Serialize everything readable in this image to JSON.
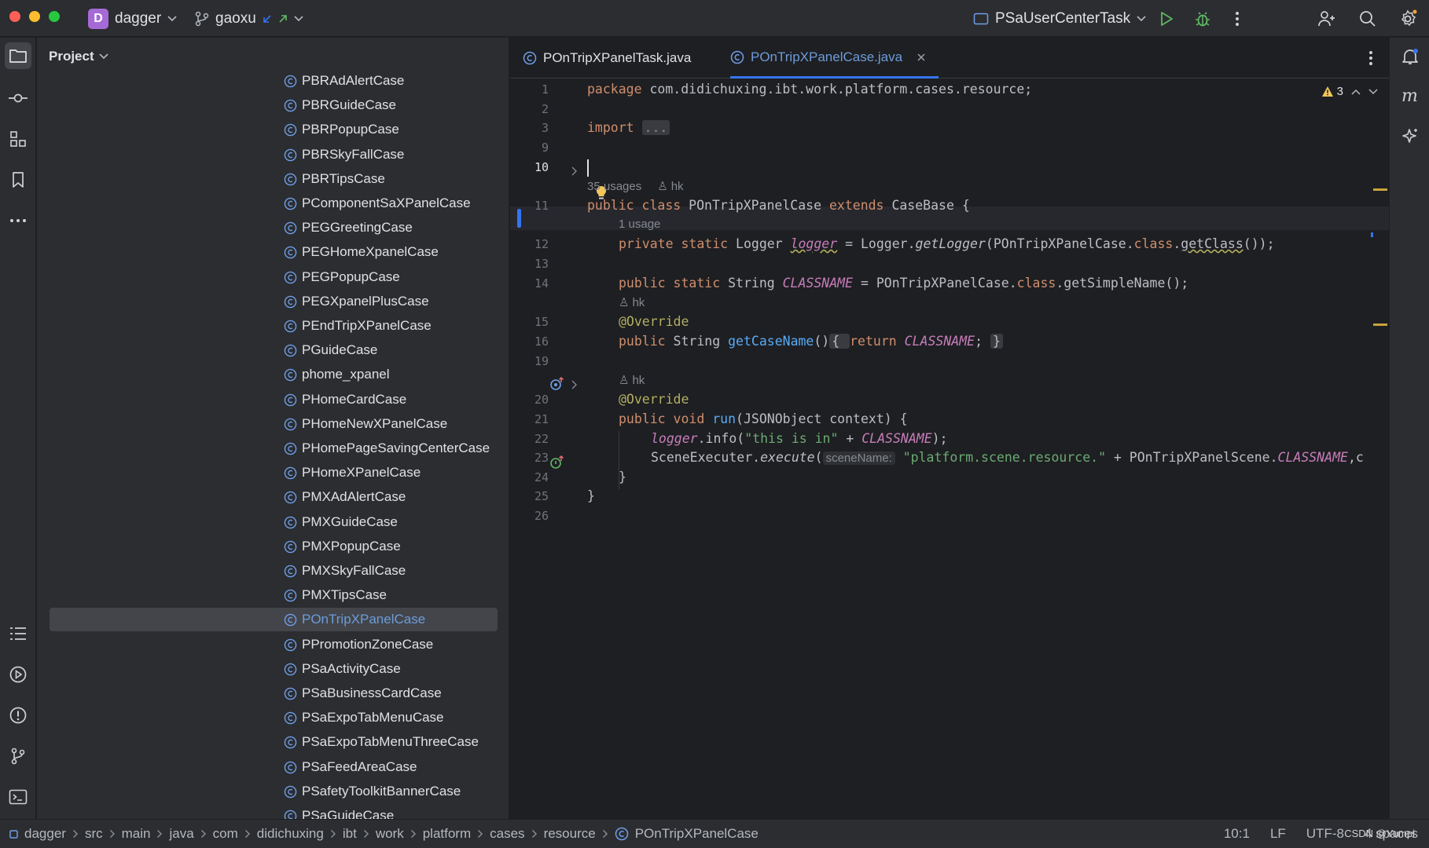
{
  "titlebar": {
    "project_badge": "D",
    "project_name": "dagger",
    "branch": "gaoxu",
    "run_config": "PSaUserCenterTask"
  },
  "project_panel": {
    "title": "Project",
    "items": [
      "PBRAdAlertCase",
      "PBRGuideCase",
      "PBRPopupCase",
      "PBRSkyFallCase",
      "PBRTipsCase",
      "PComponentSaXPanelCase",
      "PEGGreetingCase",
      "PEGHomeXpanelCase",
      "PEGPopupCase",
      "PEGXpanelPlusCase",
      "PEndTripXPanelCase",
      "PGuideCase",
      "phome_xpanel",
      "PHomeCardCase",
      "PHomeNewXPanelCase",
      "PHomePageSavingCenterCase",
      "PHomeXPanelCase",
      "PMXAdAlertCase",
      "PMXGuideCase",
      "PMXPopupCase",
      "PMXSkyFallCase",
      "PMXTipsCase",
      "POnTripXPanelCase",
      "PPromotionZoneCase",
      "PSaActivityCase",
      "PSaBusinessCardCase",
      "PSaExpoTabMenuCase",
      "PSaExpoTabMenuThreeCase",
      "PSaFeedAreaCase",
      "PSafetyToolkitBannerCase",
      "PSaGuideCase"
    ],
    "selected": "POnTripXPanelCase"
  },
  "tabs": [
    {
      "label": "POnTripXPanelTask.java",
      "active": false
    },
    {
      "label": "POnTripXPanelCase.java",
      "active": true
    }
  ],
  "editor": {
    "warnings_count": "3",
    "line_numbers": [
      "1",
      "2",
      "3",
      "9",
      "10",
      "11",
      "12",
      "13",
      "14",
      "15",
      "16",
      "19",
      "20",
      "21",
      "22",
      "23",
      "24",
      "25",
      "26"
    ],
    "lens_usages_class": "35 usages",
    "lens_author": "hk",
    "lens_usage_logger": "1 usage",
    "code": {
      "l1_kw": "package",
      "l1_rest": " com.didichuxing.ibt.work.platform.cases.resource;",
      "l3_kw": "import",
      "l3_fold": "...",
      "l11_a": "public class ",
      "l11_b": "POnTripXPanelCase ",
      "l11_c": "extends ",
      "l11_d": "CaseBase {",
      "l12_a": "private static ",
      "l12_b": "Logger ",
      "l12_c": "logger",
      "l12_d": " = Logger.",
      "l12_e": "getLogger",
      "l12_f": "(POnTripXPanelCase.",
      "l12_g": "class",
      "l12_h": ".",
      "l12_i": "getClass",
      "l12_j": "());",
      "l14_a": "public static ",
      "l14_b": "String ",
      "l14_c": "CLASSNAME",
      "l14_d": " = POnTripXPanelCase.",
      "l14_e": "class",
      "l14_f": ".getSimpleName();",
      "l15": "@Override",
      "l16_a": "public ",
      "l16_b": "String ",
      "l16_c": "getCaseName",
      "l16_d": "()",
      "l16_e": "{ ",
      "l16_f": "return ",
      "l16_g": "CLASSNAME",
      "l16_h": ";",
      "l16_i": "}",
      "l20": "@Override",
      "l21_a": "public void ",
      "l21_b": "run",
      "l21_c": "(JSONObject context) {",
      "l22_a": "logger",
      "l22_b": ".info(",
      "l22_c": "\"this is in\"",
      "l22_d": " + ",
      "l22_e": "CLASSNAME",
      "l22_f": ");",
      "l23_a": "SceneExecuter.",
      "l23_b": "execute",
      "l23_c": "(",
      "l23_hint": "sceneName:",
      "l23_d": "\"platform.scene.resource.\"",
      "l23_e": " + POnTripXPanelScene.",
      "l23_f": "CLASSNAME",
      "l23_g": ",c",
      "l24": "}",
      "l25": "}"
    }
  },
  "breadcrumbs": [
    "dagger",
    "src",
    "main",
    "java",
    "com",
    "didichuxing",
    "ibt",
    "work",
    "platform",
    "cases",
    "resource",
    "POnTripXPanelCase"
  ],
  "status": {
    "position": "10:1",
    "line_sep": "LF",
    "encoding": "UTF-8",
    "indent": "4 spaces",
    "watermark": "CSDN @Yumpi"
  }
}
